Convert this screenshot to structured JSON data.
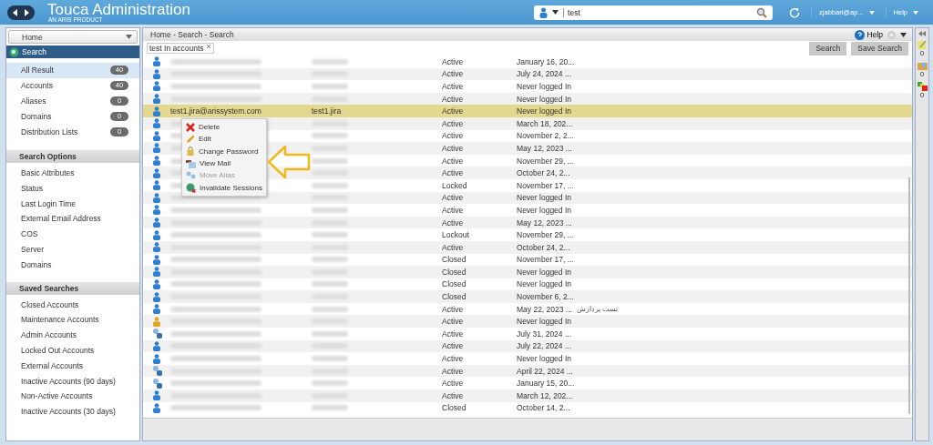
{
  "header": {
    "title": "Touca Administration",
    "subtitle": "AN ARIS PRODUCT",
    "search": {
      "value": "test"
    },
    "user": "zjabbari@ap...",
    "help": "Help"
  },
  "sidebar": {
    "home": "Home",
    "search_title": "Search",
    "results": [
      {
        "label": "All Result",
        "count": "40",
        "selected": true
      },
      {
        "label": "Accounts",
        "count": "40",
        "selected": false
      },
      {
        "label": "Aliases",
        "count": "0",
        "selected": false
      },
      {
        "label": "Domains",
        "count": "0",
        "selected": false
      },
      {
        "label": "Distribution Lists",
        "count": "0",
        "selected": false
      }
    ],
    "sections": [
      {
        "title": "Search Options",
        "items": [
          "Basic Attributes",
          "Status",
          "Last Login Time",
          "External Email Address",
          "COS",
          "Server",
          "Domains"
        ]
      },
      {
        "title": "Saved Searches",
        "items": [
          "Closed Accounts",
          "Maintenance Accounts",
          "Admin Accounts",
          "Locked Out Accounts",
          "External Accounts",
          "Inactive Accounts (90 days)",
          "Non-Active Accounts",
          "Inactive Accounts (30 days)"
        ]
      }
    ]
  },
  "main": {
    "breadcrumb": "Home - Search - Search",
    "help": "Help",
    "query_tag": "test In accounts",
    "buttons": [
      "Search",
      "Save Search"
    ]
  },
  "rows": [
    {
      "kind": "account",
      "status": "Active",
      "last_login": "January 16, 20...",
      "selected": false
    },
    {
      "kind": "account",
      "status": "Active",
      "last_login": "July 24, 2024 ...",
      "selected": false
    },
    {
      "kind": "account",
      "status": "Active",
      "last_login": "Never logged In",
      "selected": false
    },
    {
      "kind": "account",
      "status": "Active",
      "last_login": "Never logged In",
      "selected": false
    },
    {
      "kind": "account",
      "email": "test1.jira@arissystem.com",
      "name": "test1.jira",
      "status": "Active",
      "last_login": "Never logged In",
      "selected": true
    },
    {
      "kind": "account",
      "status": "Active",
      "last_login": "March 18, 202...",
      "selected": false
    },
    {
      "kind": "account",
      "status": "Active",
      "last_login": "November 2, 2...",
      "selected": false
    },
    {
      "kind": "account",
      "status": "Active",
      "last_login": "May 12, 2023 ...",
      "selected": false
    },
    {
      "kind": "account",
      "status": "Active",
      "last_login": "November 29, ...",
      "selected": false
    },
    {
      "kind": "account",
      "status": "Active",
      "last_login": "October 24, 2...",
      "selected": false
    },
    {
      "kind": "account",
      "status": "Locked",
      "last_login": "November 17, ...",
      "selected": false
    },
    {
      "kind": "account",
      "status": "Active",
      "last_login": "Never logged In",
      "selected": false
    },
    {
      "kind": "account",
      "status": "Active",
      "last_login": "Never logged In",
      "selected": false
    },
    {
      "kind": "account",
      "status": "Active",
      "last_login": "May 12, 2023 ...",
      "selected": false
    },
    {
      "kind": "account",
      "status": "Lockout",
      "last_login": "November 29, ...",
      "selected": false
    },
    {
      "kind": "account",
      "status": "Active",
      "last_login": "October 24, 2...",
      "selected": false
    },
    {
      "kind": "account",
      "status": "Closed",
      "last_login": "November 17, ...",
      "selected": false
    },
    {
      "kind": "account",
      "status": "Closed",
      "last_login": "Never logged In",
      "selected": false
    },
    {
      "kind": "account",
      "status": "Closed",
      "last_login": "Never logged In",
      "selected": false
    },
    {
      "kind": "account",
      "status": "Closed",
      "last_login": "November 6, 2...",
      "selected": false
    },
    {
      "kind": "account",
      "status": "Active",
      "last_login": "May 22, 2023 ...",
      "description": "تست پردازش",
      "selected": false
    },
    {
      "kind": "resource",
      "status": "Active",
      "last_login": "Never logged In",
      "selected": false
    },
    {
      "kind": "alias",
      "status": "Active",
      "last_login": "July 31, 2024 ...",
      "selected": false
    },
    {
      "kind": "account",
      "status": "Active",
      "last_login": "July 22, 2024 ...",
      "selected": false
    },
    {
      "kind": "account",
      "status": "Active",
      "last_login": "Never logged In",
      "selected": false
    },
    {
      "kind": "alias",
      "status": "Active",
      "last_login": "April 22, 2024 ...",
      "selected": false
    },
    {
      "kind": "alias",
      "status": "Active",
      "last_login": "January 15, 20...",
      "selected": false
    },
    {
      "kind": "account",
      "status": "Active",
      "last_login": "March 12, 202...",
      "selected": false
    },
    {
      "kind": "account",
      "status": "Closed",
      "last_login": "October 14, 2...",
      "selected": false
    }
  ],
  "context_menu": [
    {
      "kind": "delete",
      "label": "Delete",
      "disabled": false
    },
    {
      "kind": "edit",
      "label": "Edit",
      "disabled": false
    },
    {
      "kind": "password",
      "label": "Change Password",
      "disabled": false
    },
    {
      "kind": "mail",
      "label": "View Mail",
      "disabled": false
    },
    {
      "kind": "alias",
      "label": "Move Alias",
      "disabled": true
    },
    {
      "kind": "sessions",
      "label": "Invalidate Sessions",
      "disabled": false
    }
  ],
  "right_panel": {
    "counts": [
      "0",
      "0",
      "0"
    ]
  }
}
